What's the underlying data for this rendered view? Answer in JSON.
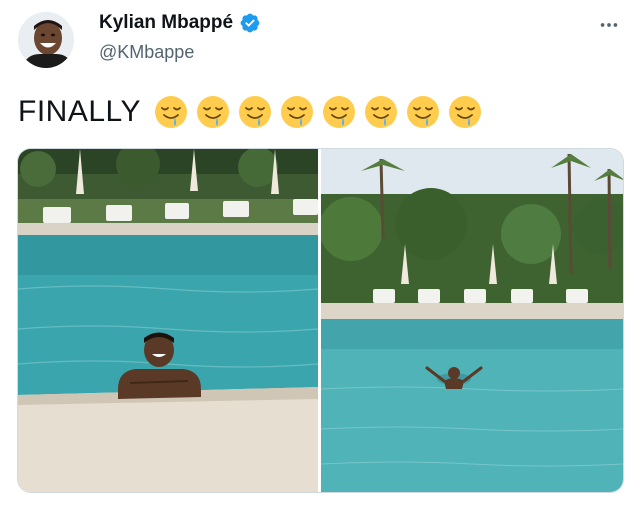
{
  "author": {
    "display_name": "Kylian Mbappé",
    "handle": "@KMbappe",
    "verified": true,
    "verified_icon": "verified-badge-icon",
    "avatar": "profile-avatar"
  },
  "menu": {
    "icon": "more-horizontal-icon"
  },
  "tweet": {
    "text": "FINALLY",
    "emoji_icon": "drooling-face-emoji",
    "emoji_count": 8
  },
  "media": {
    "photos": [
      "pool-photo-left",
      "pool-photo-right"
    ]
  },
  "colors": {
    "text": "#0f1419",
    "secondary_text": "#536471",
    "verified_blue": "#1d9bf0",
    "pool_water": "#4fb3b8"
  }
}
